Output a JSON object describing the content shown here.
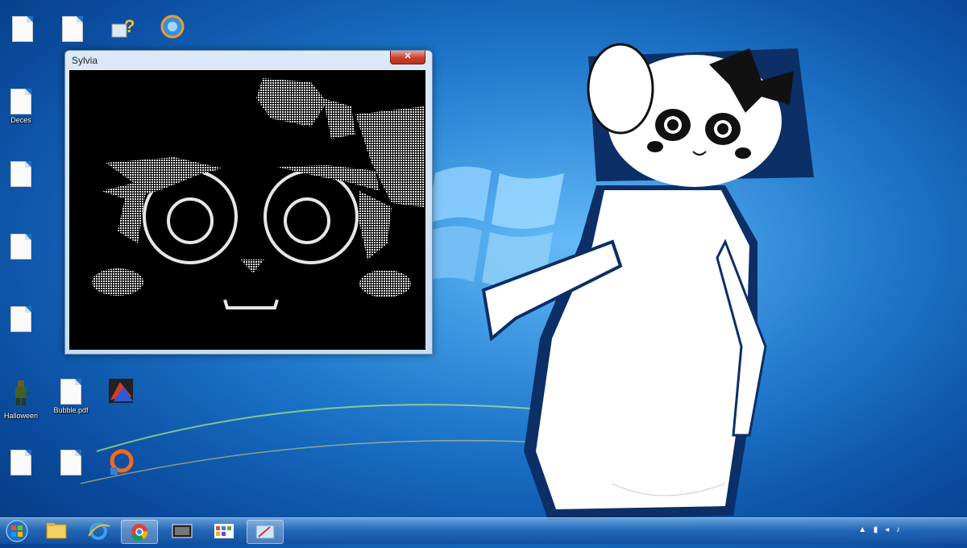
{
  "window": {
    "title": "Sylvia",
    "close_label": "✕"
  },
  "desktop_icons": [
    {
      "label": "",
      "name": "document"
    },
    {
      "label": "",
      "name": "document"
    },
    {
      "label": "",
      "name": "help"
    },
    {
      "label": "",
      "name": "network"
    },
    {
      "label": "Deces",
      "name": "file"
    },
    {
      "label": "",
      "name": "file"
    },
    {
      "label": "",
      "name": "file"
    },
    {
      "label": "",
      "name": "file"
    },
    {
      "label": "Halloween",
      "name": "game"
    },
    {
      "label": "Bubble.pdf",
      "name": "document"
    },
    {
      "label": "",
      "name": "game"
    },
    {
      "label": "",
      "name": "document"
    },
    {
      "label": "",
      "name": "document"
    },
    {
      "label": "",
      "name": "app"
    }
  ],
  "taskbar": {
    "apps": [
      "folder",
      "internet-explorer",
      "chrome",
      "media",
      "calendar",
      "paint"
    ],
    "tray_time": "",
    "tray_date": ""
  },
  "colors": {
    "wallpaper": "#1a72c8",
    "taskbar": "#2a6fb8",
    "close": "#c9412f"
  }
}
